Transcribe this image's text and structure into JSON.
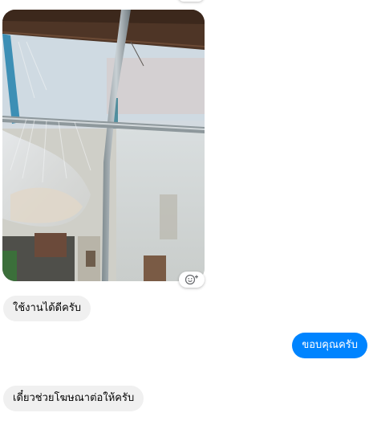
{
  "conversation": {
    "messages": [
      {
        "type": "photo",
        "direction": "incoming",
        "image_description": "greenhouse interior with mist sprinklers spraying water from metal pipes",
        "reaction_icon": "smiley-add-reaction-icon"
      },
      {
        "type": "text",
        "direction": "incoming",
        "text": "ใช้งานได้ดีครับ"
      },
      {
        "type": "text",
        "direction": "outgoing",
        "text": "ขอบคุณครับ"
      },
      {
        "type": "text",
        "direction": "incoming",
        "text": "เดี๋ยวช่วยโฆษณาต่อให้ครับ"
      }
    ]
  },
  "colors": {
    "outgoing_bubble": "#0084ff",
    "incoming_bubble": "#f0f0f0",
    "incoming_text": "#050505",
    "outgoing_text": "#ffffff"
  }
}
